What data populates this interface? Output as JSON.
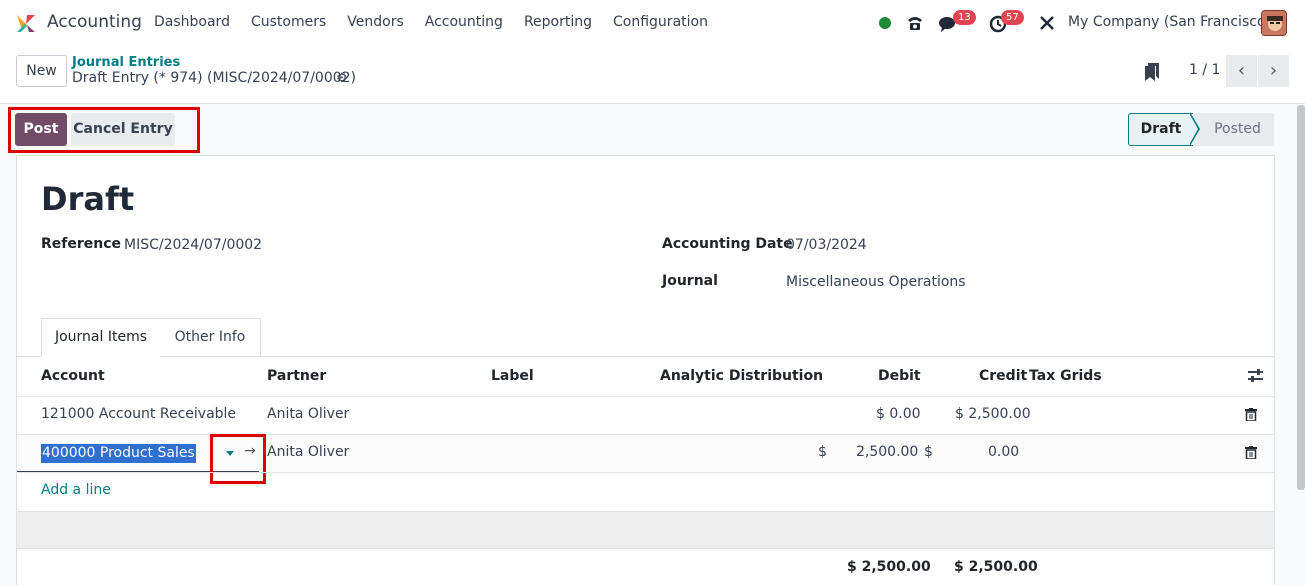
{
  "navbar": {
    "app_name": "Accounting",
    "menu": [
      "Dashboard",
      "Customers",
      "Vendors",
      "Accounting",
      "Reporting",
      "Configuration"
    ],
    "messages_count": "13",
    "activities_count": "57",
    "company": "My Company (San Francisco)"
  },
  "control": {
    "new_label": "New",
    "breadcrumb_parent": "Journal Entries",
    "breadcrumb_current": "Draft Entry (* 974) (MISC/2024/07/0002)",
    "pager": "1 / 1"
  },
  "actions": {
    "post_label": "Post",
    "cancel_label": "Cancel Entry"
  },
  "status": {
    "stages": [
      "Draft",
      "Posted"
    ],
    "current": "Draft"
  },
  "form": {
    "title": "Draft",
    "reference_label": "Reference",
    "reference_value": "MISC/2024/07/0002",
    "accounting_date_label": "Accounting Date",
    "accounting_date_value": "07/03/2024",
    "journal_label": "Journal",
    "journal_value": "Miscellaneous Operations"
  },
  "tabs": [
    "Journal Items",
    "Other Info"
  ],
  "table": {
    "headers": {
      "account": "Account",
      "partner": "Partner",
      "label": "Label",
      "analytic": "Analytic Distribution",
      "debit": "Debit",
      "credit": "Credit",
      "tax_grids": "Tax Grids"
    },
    "rows": [
      {
        "account": "121000 Account Receivable",
        "partner": "Anita Oliver",
        "debit": "$ 0.00",
        "credit": "$ 2,500.00"
      },
      {
        "account": "400000 Product Sales",
        "partner": "Anita Oliver",
        "debit_currency": "$",
        "debit": "2,500.00",
        "credit_currency": "$",
        "credit": "0.00"
      }
    ],
    "add_line": "Add a line",
    "total_debit": "$ 2,500.00",
    "total_credit": "$ 2,500.00"
  },
  "colors": {
    "brand": "#714b67",
    "accent": "#017e84",
    "highlight_box": "#e00000",
    "badge": "#e2454f"
  }
}
